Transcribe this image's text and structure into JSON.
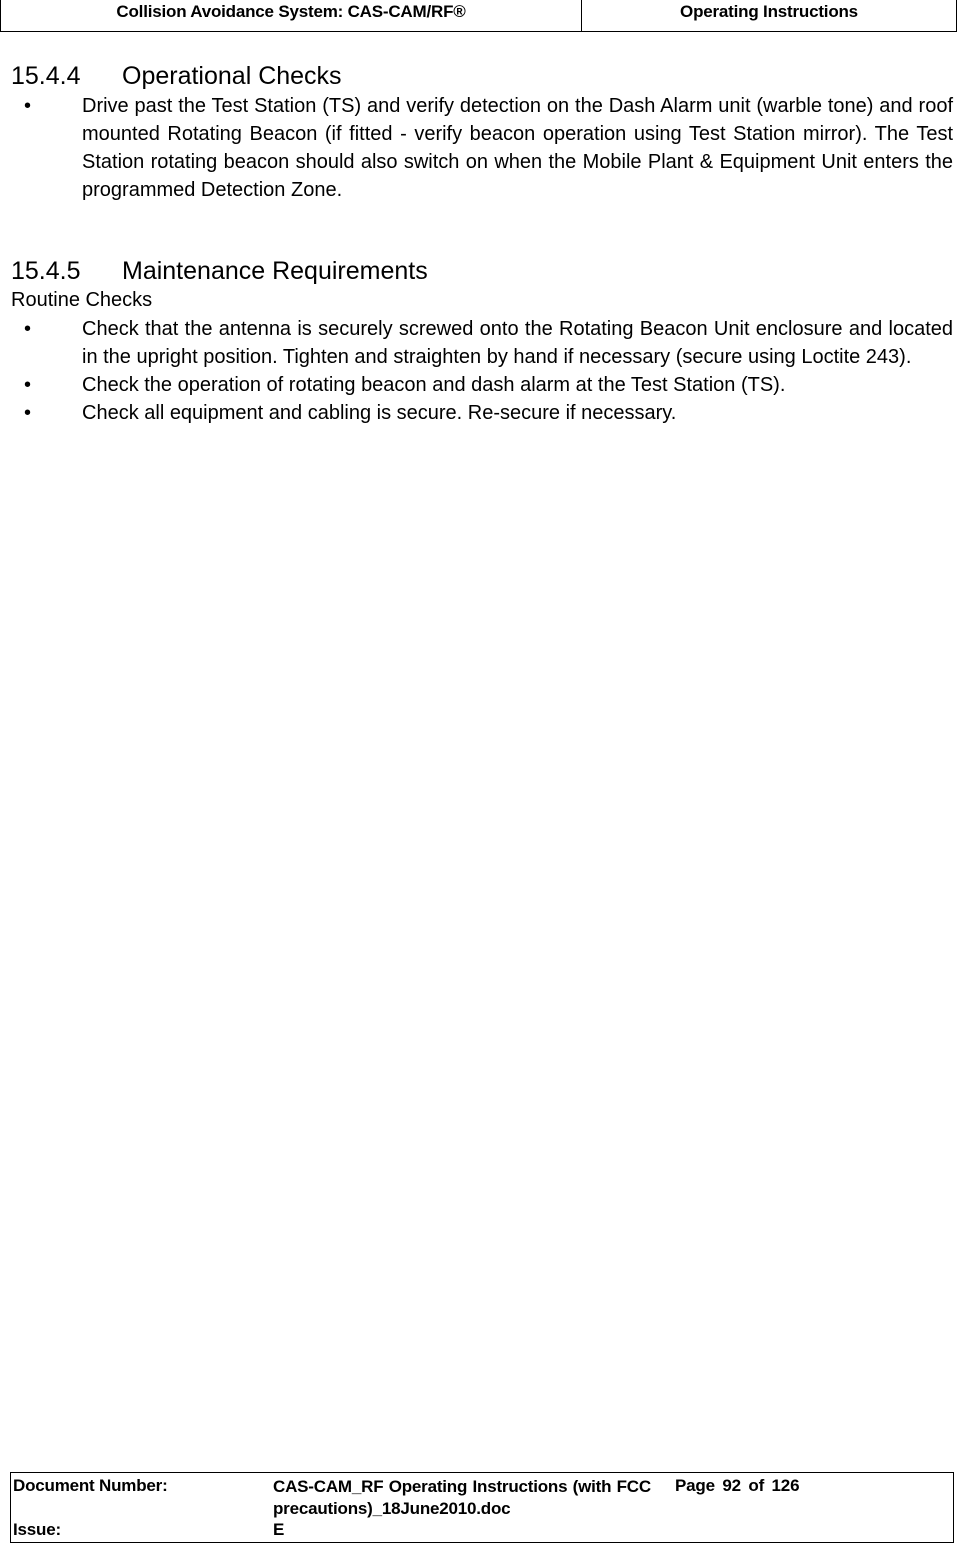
{
  "header": {
    "left_title": "Collision Avoidance System: CAS-CAM/RF®",
    "right_title": "Operating Instructions"
  },
  "sections": [
    {
      "number": "15.4.4",
      "title": "Operational Checks",
      "bullets": [
        "Drive past the Test Station (TS) and verify detection on the Dash Alarm unit (warble tone) and roof mounted Rotating Beacon (if fitted - verify beacon operation using Test Station mirror). The Test Station rotating beacon should also switch on when the Mobile Plant & Equipment Unit enters the programmed Detection Zone."
      ]
    },
    {
      "number": "15.4.5",
      "title": "Maintenance Requirements",
      "subheading": "Routine Checks",
      "bullets": [
        "Check that the antenna is securely screwed onto the Rotating Beacon Unit enclosure and located in the upright position. Tighten and straighten by hand if necessary (secure using Loctite 243).",
        "Check the operation of rotating beacon and dash alarm at the Test Station (TS).",
        "Check all equipment and cabling is secure. Re-secure if necessary."
      ]
    }
  ],
  "bullet_glyph": "•",
  "footer": {
    "doc_number_label": "Document Number:",
    "doc_name_line1_words": [
      "CAS-CAM_RF",
      "Operating",
      "Instructions",
      "(with",
      "FCC"
    ],
    "doc_name_line2": "precautions)_18June2010.doc",
    "page_text": "Page 92 of  126",
    "page_current": 92,
    "page_total": 126,
    "issue_label": "Issue:",
    "issue_value": "E"
  }
}
